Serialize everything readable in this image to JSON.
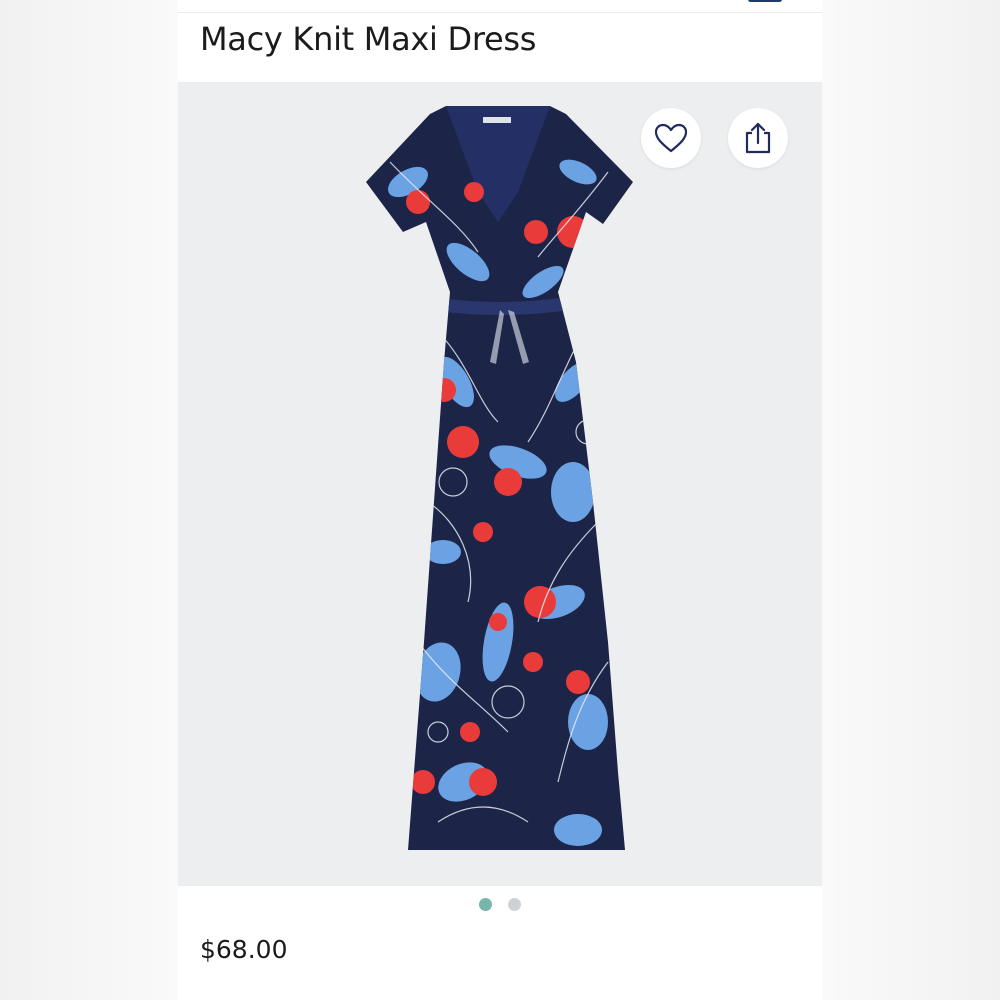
{
  "product": {
    "title": "Macy Knit Maxi Dress",
    "price": "$68.00"
  },
  "actions": {
    "favorite_icon": "heart-icon",
    "share_icon": "share-icon"
  },
  "gallery": {
    "image_count": 2,
    "active_index": 0
  },
  "colors": {
    "dress_navy": "#1c2547",
    "flower_blue": "#6aa2e3",
    "flower_red": "#ea3b3b",
    "active_dot": "#79b4ad",
    "inactive_dot": "#cfd2d4"
  }
}
